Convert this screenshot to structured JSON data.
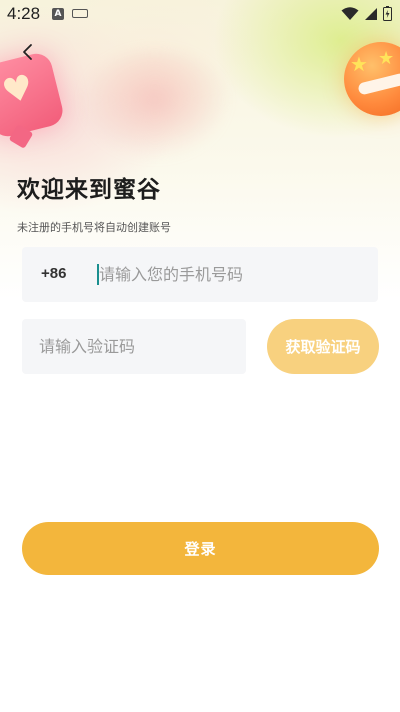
{
  "status_bar": {
    "time": "4:28",
    "left_icons": [
      "a-accessibility-icon",
      "keyboard-icon"
    ],
    "right_icons": [
      "wifi-icon",
      "cellular-signal-icon",
      "battery-charging-icon"
    ]
  },
  "header": {
    "back_icon": "chevron-left-icon",
    "title": "欢迎来到蜜谷",
    "subtitle": "未注册的手机号将自动创建账号"
  },
  "form": {
    "country_code": "+86",
    "phone_placeholder": "请输入您的手机号码",
    "phone_value": "",
    "code_placeholder": "请输入验证码",
    "code_value": "",
    "get_code_label": "获取验证码",
    "login_label": "登录"
  },
  "colors": {
    "accent": "#f3b63c",
    "accent_light": "#f8d17f",
    "input_bg": "#f5f6f8",
    "cursor": "#1a8f8f"
  }
}
